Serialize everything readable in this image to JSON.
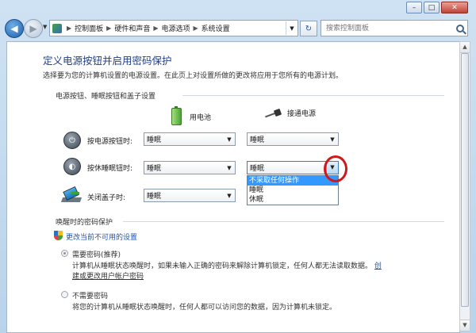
{
  "window": {
    "minimize": "–",
    "maximize": "□",
    "close": "✕"
  },
  "address": {
    "crumbs": [
      "控制面板",
      "硬件和声音",
      "电源选项",
      "系统设置"
    ],
    "search_placeholder": "搜索控制面板"
  },
  "page": {
    "title": "定义电源按钮并启用密码保护",
    "subtitle": "选择要为您的计算机设置的电源设置。在此页上对设置所做的更改将应用于您所有的电源计划。",
    "section1": "电源按钮、睡眠按钮和盖子设置",
    "col_battery": "用电池",
    "col_plugged": "接通电源",
    "rows": [
      {
        "label": "按电源按钮时:",
        "battery": "睡眠",
        "plugged": "睡眠"
      },
      {
        "label": "按休睡眠钮时:",
        "battery": "睡眠",
        "plugged": "睡眠"
      },
      {
        "label": "关闭盖子时:",
        "battery": "睡眠",
        "plugged": ""
      }
    ],
    "dropdown_options": [
      "不采取任何操作",
      "睡眠",
      "休眠"
    ],
    "section2": "唤醒时的密码保护",
    "change_link": "更改当前不可用的设置",
    "opt1_label": "需要密码(推荐)",
    "opt1_desc1": "计算机从睡眠状态唤醒时，如果未输入正确的密码来解除计算机锁定，任何人都无法读取数据。",
    "opt1_link_a": "创",
    "opt1_link_b": "建或更改用户帐户密码",
    "opt2_label": "不需要密码",
    "opt2_desc": "将您的计算机从睡眠状态唤醒时，任何人都可以访问您的数据，因为计算机未锁定。"
  },
  "colors": {
    "link": "#1f55b6",
    "title": "#1e3f8a",
    "highlight": "#3399ff",
    "annotation": "#d0191c"
  }
}
